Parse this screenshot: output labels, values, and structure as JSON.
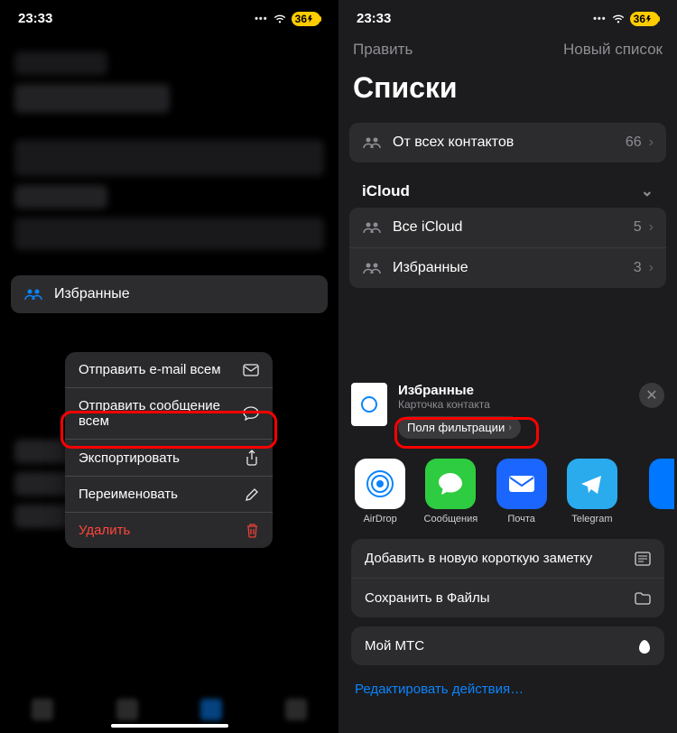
{
  "status": {
    "time": "23:33",
    "battery": "36"
  },
  "left": {
    "selected_list": "Избранные",
    "menu": {
      "email_all": "Отправить e-mail всем",
      "message_all": "Отправить сообщение всем",
      "export": "Экспортировать",
      "rename": "Переименовать",
      "delete": "Удалить"
    }
  },
  "right": {
    "nav_edit": "Править",
    "nav_new": "Новый список",
    "title": "Списки",
    "all_contacts": {
      "label": "От всех контактов",
      "count": "66"
    },
    "icloud_section": "iCloud",
    "icloud_all": {
      "label": "Все iCloud",
      "count": "5"
    },
    "icloud_fav": {
      "label": "Избранные",
      "count": "3"
    },
    "sheet": {
      "title": "Избранные",
      "subtitle": "Карточка контакта",
      "filter": "Поля фильтрации"
    },
    "apps": {
      "airdrop": "AirDrop",
      "messages": "Сообщения",
      "mail": "Почта",
      "telegram": "Telegram"
    },
    "actions": {
      "note": "Добавить в новую короткую заметку",
      "files": "Сохранить в Файлы",
      "mts": "Мой МТС",
      "edit": "Редактировать действия…"
    }
  }
}
